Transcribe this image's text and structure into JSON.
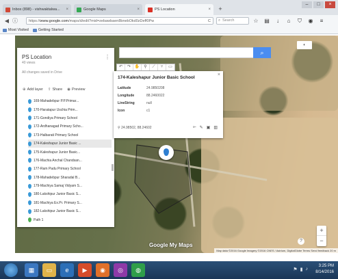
{
  "browser": {
    "tabs": [
      {
        "label": "Inbox (898) - vishwaktalwa...",
        "favicon_color": "#d14836",
        "active": false
      },
      {
        "label": "Google Maps",
        "favicon_color": "#34a853",
        "active": false
      },
      {
        "label": "PS Location",
        "favicon_color": "#d93025",
        "active": true
      }
    ],
    "url_prefix": "https://",
    "url_host": "www.google.com",
    "url_path": "/maps/d/edit?mid=zebawbaen8bnebOkd0zDeff0Pw",
    "search_placeholder": "Search",
    "bookmarks": [
      "Most Visited",
      "Getting Started"
    ]
  },
  "map": {
    "logo": "Google My Maps",
    "attribution": "Map data ©2016 Google Imagery ©2016 CNES / Astrium, DigitalGlobe  Terms  Send feedback  20 m",
    "help_icon_label": "?",
    "zoom_in": "+",
    "zoom_out": "−"
  },
  "layers_panel": {
    "title": "PS Location",
    "views": "40 views",
    "saved_status": "All changes saved in Drive",
    "actions": {
      "add_layer": "Add layer",
      "share": "Share",
      "preview": "Preview"
    },
    "items": [
      "169-Mahadebpur P.P.Primar...",
      "170-Haratapur Uschia Prim...",
      "171-Gondiya Primary School",
      "172-Ardhanagad Primary Scho...",
      "173-Halbarati Primary School",
      "174-Kaleshapur Junior Basic ...",
      "175-Kaleshapur Junior Basic...",
      "176-Machia Anchal Chandsan...",
      "177-Ram Padu Primary School",
      "178-Mahadebpur Sharadal B...",
      "179-Machiya Samaj Vidyam S...",
      "180-Lakshipur Junior Basic S...",
      "181-Machiya Ex.Pr. Primary S...",
      "182-Lakshipur Junior Basic S..."
    ],
    "partial_item": "Path 1",
    "selected_index": 5
  },
  "info_card": {
    "title": "174-Kaleshapur Junior Basic School",
    "fields": [
      {
        "label": "Latitude",
        "value": "24.9850208"
      },
      {
        "label": "Longitude",
        "value": "88.2460022"
      },
      {
        "label": "LineString",
        "value": "null"
      },
      {
        "label": "Icon",
        "value": "c1"
      }
    ],
    "coords": "24.98502, 88.24602"
  },
  "taskbar": {
    "time": "3:25 PM",
    "date": "8/14/2016"
  }
}
